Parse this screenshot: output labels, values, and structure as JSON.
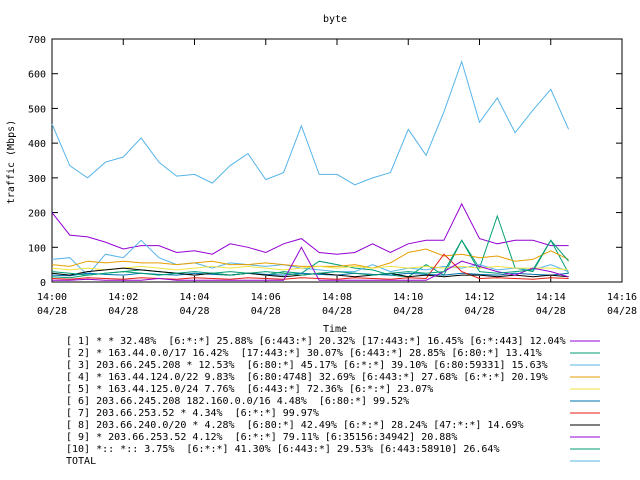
{
  "chart_data": {
    "type": "line",
    "title": "byte",
    "xlabel": "Time",
    "ylabel": "traffic (Mbps)",
    "ylim": [
      0,
      700
    ],
    "y_ticks": [
      0,
      100,
      200,
      300,
      400,
      500,
      600,
      700
    ],
    "x_ticks": [
      {
        "time": "14:00",
        "date": "04/28"
      },
      {
        "time": "14:02",
        "date": "04/28"
      },
      {
        "time": "14:04",
        "date": "04/28"
      },
      {
        "time": "14:06",
        "date": "04/28"
      },
      {
        "time": "14:08",
        "date": "04/28"
      },
      {
        "time": "14:10",
        "date": "04/28"
      },
      {
        "time": "14:12",
        "date": "04/28"
      },
      {
        "time": "14:14",
        "date": "04/28"
      },
      {
        "time": "14:16",
        "date": "04/28"
      }
    ],
    "x_range": [
      "04/28 14:00",
      "04/28 14:16"
    ],
    "x": [
      "14:00",
      "14:00:30",
      "14:01",
      "14:01:30",
      "14:02",
      "14:02:30",
      "14:03",
      "14:03:30",
      "14:04",
      "14:04:30",
      "14:05",
      "14:05:30",
      "14:06",
      "14:06:30",
      "14:07",
      "14:07:30",
      "14:08",
      "14:08:30",
      "14:09",
      "14:09:30",
      "14:10",
      "14:10:30",
      "14:11",
      "14:11:30",
      "14:12",
      "14:12:30",
      "14:13",
      "14:13:30",
      "14:14",
      "14:14:30"
    ],
    "grid": false,
    "legend_position": "bottom",
    "series": [
      {
        "name": "[ 1] * * 32.48%  [6:*:*] 25.88% [6:443:*] 20.32% [17:443:*] 16.45% [6:*:443] 12.04%",
        "color": "#9400d3",
        "values": [
          200,
          135,
          130,
          115,
          95,
          105,
          105,
          85,
          90,
          80,
          110,
          100,
          85,
          110,
          125,
          85,
          80,
          85,
          110,
          85,
          110,
          120,
          120,
          225,
          125,
          110,
          120,
          120,
          105,
          105
        ]
      },
      {
        "name": "[ 2] * 163.44.0.0/17 16.42%  [17:443:*] 30.07% [6:443:*] 28.85% [6:80:*] 13.41%",
        "color": "#009e73",
        "values": [
          15,
          12,
          20,
          25,
          30,
          35,
          30,
          25,
          20,
          25,
          30,
          25,
          20,
          30,
          25,
          60,
          50,
          40,
          35,
          20,
          15,
          50,
          20,
          120,
          40,
          190,
          40,
          30,
          120,
          25
        ]
      },
      {
        "name": "[ 3] 203.66.245.208 * 12.53%  [6:80:*] 45.17% [6:*:*] 39.10% [6:80:59331] 15.63%",
        "color": "#56b4e9",
        "values": [
          65,
          70,
          20,
          80,
          70,
          120,
          70,
          50,
          55,
          40,
          55,
          50,
          45,
          50,
          40,
          35,
          30,
          30,
          50,
          30,
          40,
          35,
          45,
          40,
          50,
          35,
          40,
          35,
          50,
          30
        ]
      },
      {
        "name": "[ 4] * 163.44.124.0/22 9.83%  [6:80:4748] 32.69% [6:443:*] 27.68% [6:*:*] 20.19%",
        "color": "#e69f00",
        "values": [
          50,
          45,
          60,
          55,
          60,
          55,
          55,
          50,
          55,
          60,
          50,
          50,
          55,
          50,
          45,
          45,
          45,
          50,
          40,
          55,
          85,
          95,
          75,
          80,
          70,
          75,
          60,
          65,
          90,
          65
        ]
      },
      {
        "name": "[ 5] * 163.44.125.0/24 7.76%  [6:443:*] 72.36% [6:*:*] 23.07%",
        "color": "#f0e442",
        "values": [
          40,
          35,
          40,
          35,
          40,
          45,
          40,
          35,
          40,
          45,
          40,
          45,
          40,
          35,
          40,
          45,
          40,
          45,
          40,
          45,
          40,
          45,
          40,
          45,
          40,
          45,
          40,
          40,
          40,
          35
        ]
      },
      {
        "name": "[ 6] 203.66.245.208 182.160.0.0/16 4.48%  [6:80:*] 99.52%",
        "color": "#0072b2",
        "values": [
          20,
          18,
          25,
          22,
          20,
          25,
          22,
          20,
          25,
          22,
          20,
          25,
          22,
          20,
          25,
          22,
          20,
          25,
          22,
          20,
          25,
          22,
          20,
          25,
          22,
          20,
          25,
          22,
          20,
          25
        ]
      },
      {
        "name": "[ 7] 203.66.253.52 * 4.34%  [6:*:*] 99.97%",
        "color": "#e51e10",
        "values": [
          10,
          8,
          12,
          10,
          8,
          12,
          10,
          8,
          12,
          10,
          8,
          12,
          10,
          8,
          12,
          10,
          8,
          12,
          10,
          8,
          12,
          10,
          80,
          30,
          10,
          12,
          10,
          8,
          12,
          10
        ]
      },
      {
        "name": "[ 8] 203.66.240.0/20 * 4.28%  [6:80:*] 42.49% [6:*:*] 28.24% [47:*:*] 14.69%",
        "color": "#000000",
        "values": [
          25,
          20,
          30,
          35,
          40,
          35,
          30,
          25,
          20,
          25,
          20,
          25,
          20,
          15,
          20,
          25,
          20,
          15,
          20,
          25,
          15,
          20,
          15,
          20,
          20,
          15,
          20,
          15,
          20,
          15
        ]
      },
      {
        "name": "[ 9] * 203.66.253.52 4.12%  [6:*:*] 79.11% [6:35156:34942] 20.88%",
        "color": "#9400d3",
        "values": [
          5,
          5,
          8,
          5,
          5,
          5,
          10,
          5,
          5,
          5,
          5,
          5,
          5,
          5,
          100,
          5,
          5,
          5,
          5,
          5,
          5,
          5,
          30,
          60,
          45,
          30,
          20,
          40,
          30,
          15
        ]
      },
      {
        "name": "[10] *:: *:: 3.75%  [6:*:*] 41.30% [6:443:*] 29.53% [6:443:58910] 26.64%",
        "color": "#009e73",
        "values": [
          30,
          25,
          20,
          25,
          30,
          25,
          20,
          25,
          30,
          25,
          20,
          25,
          30,
          25,
          20,
          25,
          30,
          25,
          20,
          25,
          30,
          25,
          30,
          120,
          30,
          25,
          30,
          35,
          120,
          60
        ]
      },
      {
        "name": "TOTAL",
        "color": "#56b4e9",
        "values": [
          455,
          335,
          300,
          345,
          360,
          415,
          345,
          305,
          310,
          285,
          335,
          370,
          295,
          315,
          450,
          310,
          310,
          280,
          300,
          315,
          440,
          365,
          490,
          635,
          460,
          530,
          430,
          495,
          555,
          440
        ]
      }
    ]
  }
}
